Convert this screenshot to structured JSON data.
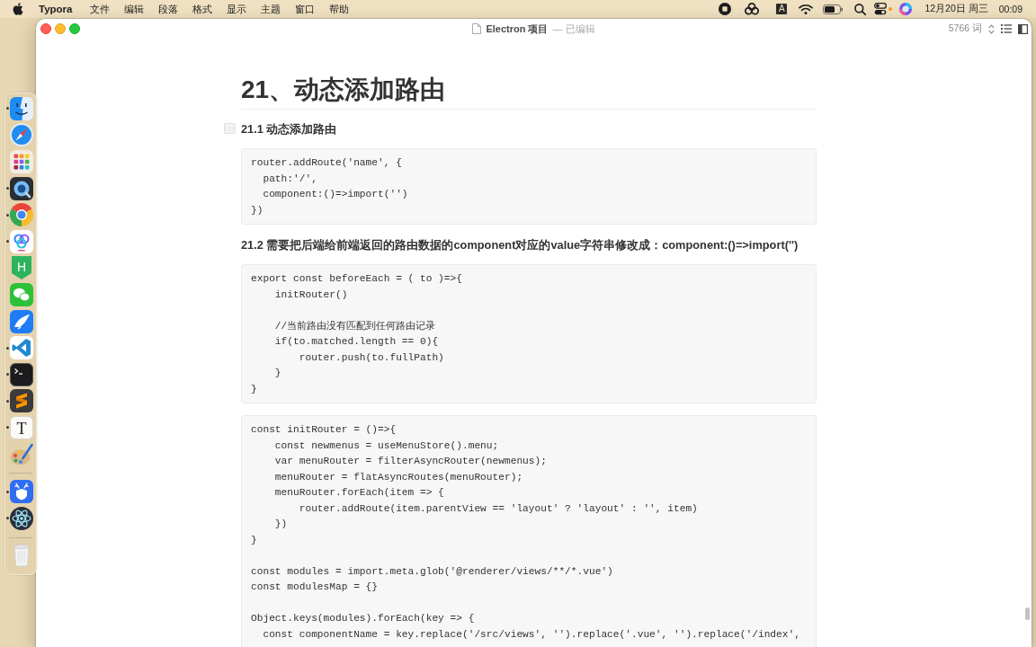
{
  "menu_bar": {
    "app_name": "Typora",
    "menus": [
      "文件",
      "编辑",
      "段落",
      "格式",
      "显示",
      "主题",
      "窗口",
      "帮助"
    ],
    "input_source": "A",
    "date": "12月20日 周三",
    "time": "00:09"
  },
  "dock": {
    "groups": [
      {
        "items": [
          {
            "kind": "face",
            "running": true
          },
          {
            "kind": "compass",
            "running": false
          },
          {
            "kind": "grid",
            "running": false
          },
          {
            "kind": "lens",
            "running": true
          },
          {
            "kind": "wheel",
            "running": true
          },
          {
            "kind": "rings",
            "running": true
          },
          {
            "kind": "badge",
            "label": "H",
            "running": false
          },
          {
            "kind": "bubbles",
            "running": false
          },
          {
            "kind": "wing",
            "running": false
          },
          {
            "kind": "ribbon",
            "running": true
          },
          {
            "kind": "prompt",
            "running": true
          },
          {
            "kind": "stroke",
            "running": true
          },
          {
            "kind": "letter",
            "label": "T",
            "running": true
          },
          {
            "kind": "palette",
            "running": false
          }
        ]
      },
      {
        "items": [
          {
            "kind": "shield",
            "running": true
          },
          {
            "kind": "atom",
            "running": true
          }
        ]
      },
      {
        "items": [
          {
            "kind": "bin",
            "running": false
          }
        ]
      }
    ]
  },
  "window": {
    "title": "Electron 项目",
    "edited_note": "— 已编辑",
    "word_count": "5766 词"
  },
  "document": {
    "blocks": [
      {
        "kind": "h1",
        "text": "21、动态添加路由"
      },
      {
        "kind": "h2",
        "text": "21.1 动态添加路由",
        "handle": true
      },
      {
        "kind": "code",
        "text": "router.addRoute('name', {\n  path:'/',\n  component:()=>import('')\n})"
      },
      {
        "kind": "h2",
        "text": "21.2 需要把后端给前端返回的路由数据的component对应的value字符串修改成：component:()=>import('')",
        "handle": false
      },
      {
        "kind": "code",
        "text": "export const beforeEach = ( to )=>{\n    initRouter()\n\n    //当前路由没有匹配到任何路由记录\n    if(to.matched.length == 0){\n        router.push(to.fullPath)\n    }\n}"
      },
      {
        "kind": "code",
        "text": "const initRouter = ()=>{\n    const newmenus = useMenuStore().menu;\n    var menuRouter = filterAsyncRouter(newmenus);\n    menuRouter = flatAsyncRoutes(menuRouter);\n    menuRouter.forEach(item => {\n        router.addRoute(item.parentView == 'layout' ? 'layout' : '', item)\n    })\n}\n\nconst modules = import.meta.glob('@renderer/views/**/*.vue')\nconst modulesMap = {}\n\nObject.keys(modules).forEach(key => {\n  const componentName = key.replace('/src/views', '').replace('.vue', '').replace('/index',"
      }
    ]
  }
}
